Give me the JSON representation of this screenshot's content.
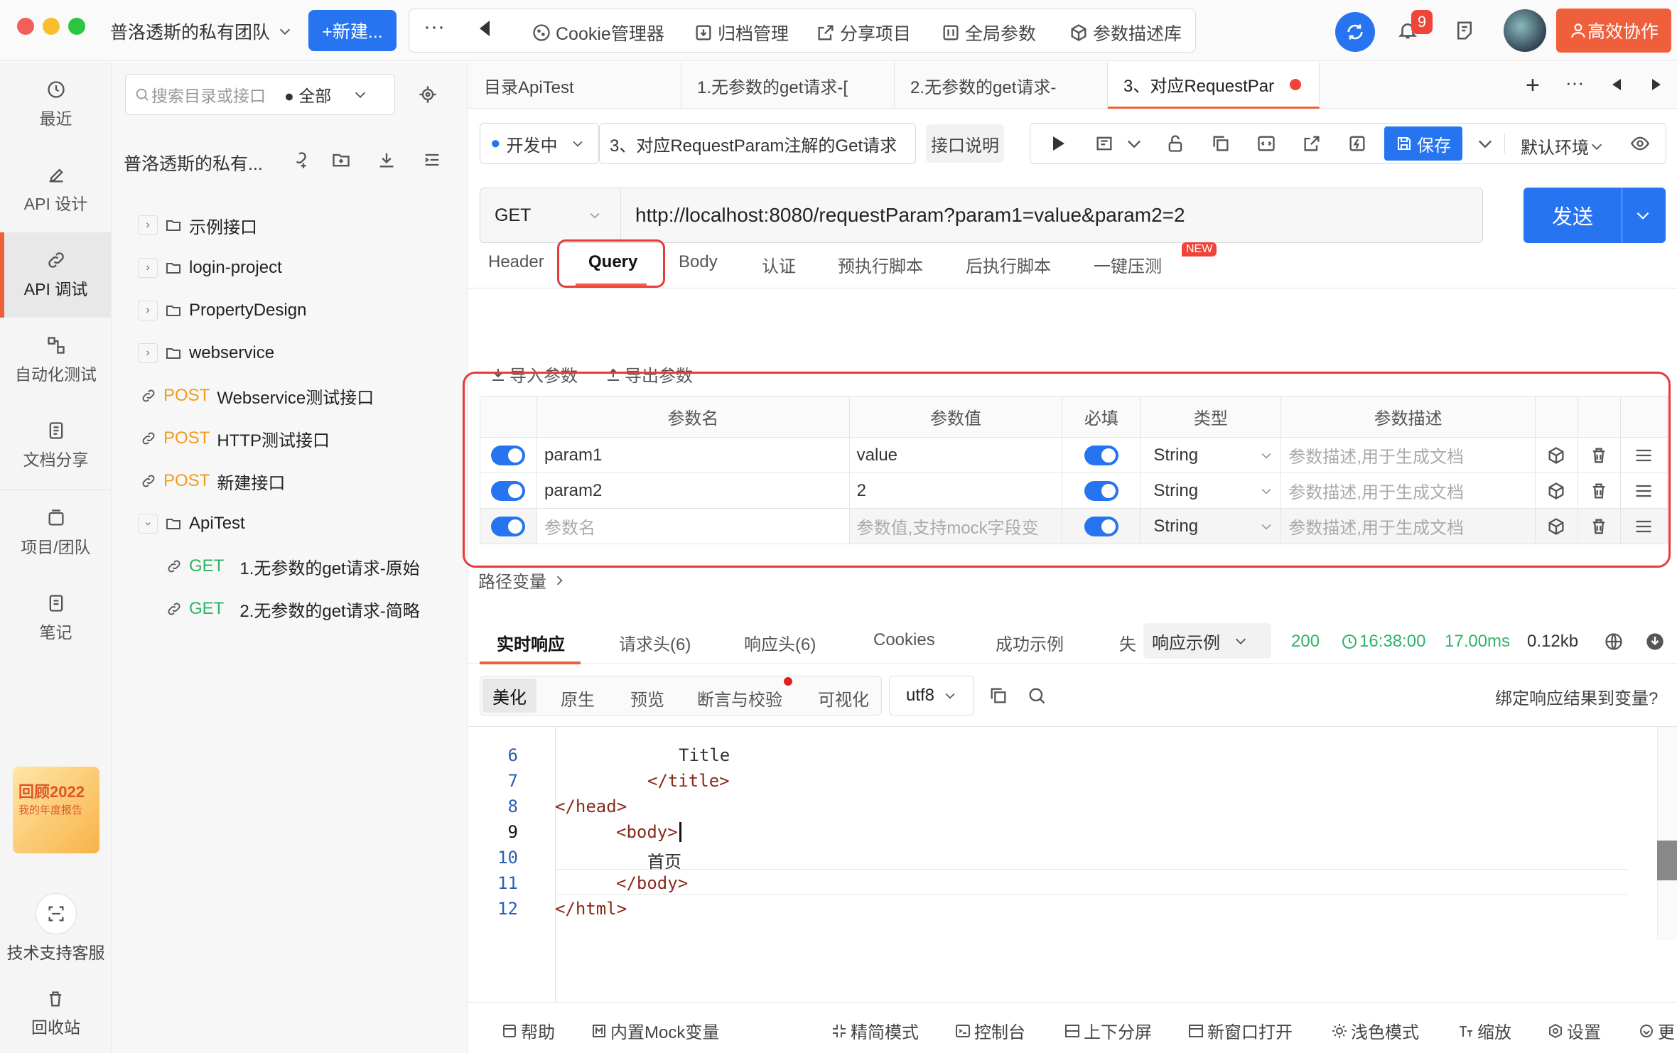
{
  "topbar": {
    "team_title": "普洛透斯的私有团队",
    "new_label": "+新建...",
    "toolbar": [
      "Cookie管理器",
      "归档管理",
      "分享项目",
      "全局参数",
      "参数描述库"
    ],
    "notif_count": "9",
    "collab_label": "高效协作"
  },
  "leftnav": {
    "items": [
      "最近",
      "API 设计",
      "API 调试",
      "自动化测试",
      "文档分享",
      "项目/团队",
      "笔记"
    ],
    "promo_title": "回顾2022",
    "promo_sub": "我的年度报告",
    "support": "技术支持客服",
    "trash": "回收站"
  },
  "tree": {
    "search_placeholder": "搜索目录或接口",
    "filter": "全部",
    "project": "普洛透斯的私有...",
    "items": [
      {
        "type": "folder",
        "label": "示例接口"
      },
      {
        "type": "folder",
        "label": "login-project"
      },
      {
        "type": "folder",
        "label": "PropertyDesign"
      },
      {
        "type": "folder",
        "label": "webservice"
      },
      {
        "type": "api",
        "method": "POST",
        "label": "Webservice测试接口"
      },
      {
        "type": "api",
        "method": "POST",
        "label": "HTTP测试接口"
      },
      {
        "type": "api",
        "method": "POST",
        "label": "新建接口"
      },
      {
        "type": "folder-open",
        "label": "ApiTest"
      },
      {
        "type": "api",
        "method": "GET",
        "label": "1.无参数的get请求-原始"
      },
      {
        "type": "api",
        "method": "GET",
        "label": "2.无参数的get请求-简略"
      }
    ]
  },
  "tabs": [
    "目录ApiTest",
    "1.无参数的get请求-[",
    "2.无参数的get请求-",
    "3、对应RequestPar"
  ],
  "request": {
    "status": "开发中",
    "name": "3、对应RequestParam注解的Get请求",
    "doc_btn": "接口说明",
    "save": "保存",
    "env": "默认环境",
    "method": "GET",
    "url": "http://localhost:8080/requestParam?param1=value&param2=2",
    "send": "发送"
  },
  "subtabs": [
    "Header",
    "Query",
    "Body",
    "认证",
    "预执行脚本",
    "后执行脚本",
    "一键压测"
  ],
  "new_badge": "NEW",
  "import_label": "导入参数",
  "export_label": "导出参数",
  "params": {
    "headers": [
      "参数名",
      "参数值",
      "必填",
      "类型",
      "参数描述"
    ],
    "rows": [
      {
        "name": "param1",
        "value": "value",
        "type": "String",
        "desc": "参数描述,用于生成文档"
      },
      {
        "name": "param2",
        "value": "2",
        "type": "String",
        "desc": "参数描述,用于生成文档"
      },
      {
        "name": "参数名",
        "value": "参数值,支持mock字段变",
        "type": "String",
        "desc": "参数描述,用于生成文档"
      }
    ]
  },
  "path_vars": "路径变量",
  "response": {
    "tabs": [
      "实时响应",
      "请求头(6)",
      "响应头(6)",
      "Cookies",
      "成功示例",
      "失"
    ],
    "example": "响应示例",
    "code": "200",
    "time": "16:38:00",
    "duration": "17.00ms",
    "size": "0.12kb",
    "view_tabs": [
      "美化",
      "原生",
      "预览",
      "断言与校验",
      "可视化"
    ],
    "encoding": "utf8",
    "bind": "绑定响应结果到变量?",
    "lines": [
      {
        "n": "6",
        "text": "Title"
      },
      {
        "n": "7",
        "text": "</title>"
      },
      {
        "n": "8",
        "text": "</head>"
      },
      {
        "n": "9",
        "text": "<body>"
      },
      {
        "n": "10",
        "text": "首页"
      },
      {
        "n": "11",
        "text": "</body>"
      },
      {
        "n": "12",
        "text": "</html>"
      }
    ]
  },
  "bottombar": [
    "帮助",
    "内置Mock变量",
    "精简模式",
    "控制台",
    "上下分屏",
    "新窗口打开",
    "浅色模式",
    "缩放",
    "设置",
    "更"
  ]
}
